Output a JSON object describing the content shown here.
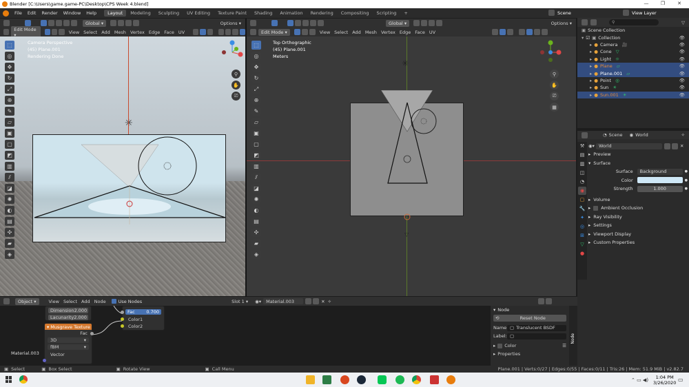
{
  "window": {
    "title": "Blender [C:\\Users\\game.game-PC\\Desktop\\CPS Week 4.blend]"
  },
  "menu": {
    "items": [
      "File",
      "Edit",
      "Render",
      "Window",
      "Help"
    ],
    "workspaces": [
      "Layout",
      "Modeling",
      "Sculpting",
      "UV Editing",
      "Texture Paint",
      "Shading",
      "Animation",
      "Rendering",
      "Compositing",
      "Scripting",
      "+"
    ],
    "scene_label": "Scene",
    "view_layer_label": "View Layer"
  },
  "left_viewport": {
    "mode": "Edit Mode",
    "menus": [
      "View",
      "Select",
      "Add",
      "Mesh",
      "Vertex",
      "Edge",
      "Face",
      "UV"
    ],
    "orientation": "Global",
    "options_label": "Options",
    "overlay_lines": [
      "Camera Perspective",
      "(45) Plane.001",
      "Rendering Done"
    ]
  },
  "right_viewport": {
    "mode": "Edit Mode",
    "menus": [
      "View",
      "Select",
      "Add",
      "Mesh",
      "Vertex",
      "Edge",
      "Face",
      "UV"
    ],
    "orientation": "Global",
    "options_label": "Options",
    "overlay_lines": [
      "Top Orthographic",
      "(45) Plane.001",
      "Meters"
    ]
  },
  "outliner": {
    "header_label": "Scene Collection",
    "collection": "Collection",
    "items": [
      {
        "name": "Camera",
        "selected": false,
        "color": "#dddddd"
      },
      {
        "name": "Cone",
        "selected": false,
        "color": "#dddddd"
      },
      {
        "name": "Light",
        "selected": false,
        "color": "#dddddd"
      },
      {
        "name": "Plane",
        "selected": true,
        "color": "#e58a3a"
      },
      {
        "name": "Plane.001",
        "selected": true,
        "color": "#ffffff"
      },
      {
        "name": "Point",
        "selected": false,
        "color": "#dddddd"
      },
      {
        "name": "Sun",
        "selected": false,
        "color": "#dddddd"
      },
      {
        "name": "Sun.001",
        "selected": true,
        "color": "#e58a3a"
      }
    ]
  },
  "properties": {
    "breadcrumb_scene": "Scene",
    "breadcrumb_world": "World",
    "world_name": "World",
    "sections": {
      "preview": "Preview",
      "surface": "Surface",
      "volume": "Volume",
      "ambient_occlusion": "Ambient Occlusion",
      "ray_visibility": "Ray Visibility",
      "settings": "Settings",
      "viewport_display": "Viewport Display",
      "custom_properties": "Custom Properties"
    },
    "surface_label": "Surface",
    "surface_value": "Background",
    "color_label": "Color",
    "color_value": "#cfe8f7",
    "strength_label": "Strength",
    "strength_value": "1.000"
  },
  "node_editor": {
    "header": {
      "editor_type": "Object",
      "menus": [
        "View",
        "Select",
        "Add",
        "Node"
      ],
      "use_nodes": "Use Nodes",
      "slot": "Slot 1",
      "material": "Material.003"
    },
    "musgrave": {
      "title": "Musgrave Texture",
      "output": "Fac",
      "dimensions_select": "3D",
      "type_select": "fBM",
      "input_vector": "Vector",
      "dimension_label": "Dimension",
      "dimension_value": "2.000",
      "lacunarity_label": "Lacunarity",
      "lacunarity_value": "2.000"
    },
    "mix_node": {
      "fac_label": "Fac",
      "fac_value": "0.700",
      "color1": "Color1",
      "color2": "Color2"
    },
    "material_label": "Material.003",
    "sidebar": {
      "header": "Node",
      "reset_button": "Reset Node",
      "name_label": "Name:",
      "name_value": "Translucent BSDF",
      "label_label": "Label:",
      "color_label": "Color",
      "properties_label": "Properties",
      "tab_node": "Node"
    }
  },
  "status_bar": {
    "select": "Select",
    "box_select": "Box Select",
    "rotate_view": "Rotate View",
    "call_menu": "Call Menu",
    "stats": "Plane.001 | Verts:0/27 | Edges:0/55 | Faces:0/11 | Tris:26 | Mem: 51.9 MiB | v2.82.7"
  },
  "taskbar": {
    "time": "1:04 PM",
    "date": "3/26/2020"
  }
}
